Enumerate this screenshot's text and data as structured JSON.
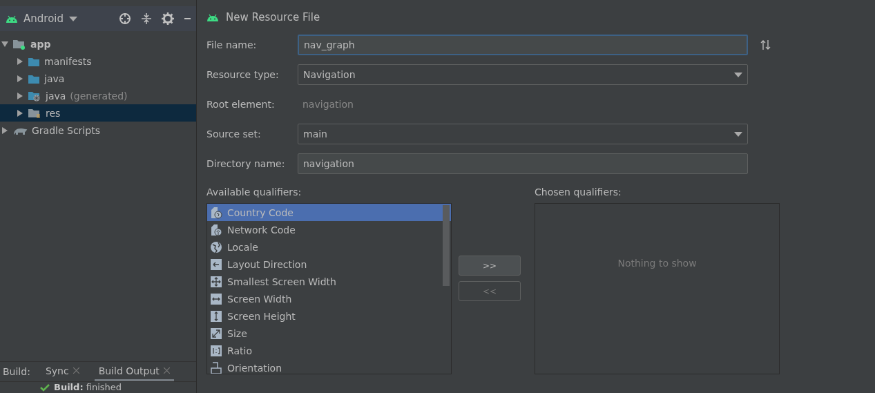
{
  "project_panel": {
    "view_selector": {
      "label": "Android"
    },
    "tree": [
      {
        "label": "app",
        "kind": "module",
        "expanded": true,
        "selected": false,
        "children": [
          {
            "label": "manifests",
            "kind": "folder",
            "expanded": false,
            "selected": false
          },
          {
            "label": "java",
            "kind": "folder",
            "expanded": false,
            "selected": false
          },
          {
            "label": "java",
            "suffix": "(generated)",
            "kind": "generated",
            "expanded": false,
            "selected": false
          },
          {
            "label": "res",
            "kind": "res",
            "expanded": false,
            "selected": true
          }
        ]
      },
      {
        "label": "Gradle Scripts",
        "kind": "gradle",
        "expanded": false,
        "selected": false
      }
    ]
  },
  "build_panel": {
    "label": "Build:",
    "tabs": [
      {
        "label": "Sync",
        "selected": false
      },
      {
        "label": "Build Output",
        "selected": true
      }
    ],
    "status": {
      "text": "**Build:** finished"
    }
  },
  "dialog": {
    "title": "New Resource File",
    "fields": [
      {
        "kind": "text",
        "label": "File name:",
        "value": "nav_graph",
        "focused": true
      },
      {
        "kind": "dropdown",
        "label": "Resource type:",
        "value": "Navigation"
      },
      {
        "kind": "readonly",
        "label": "Root element:",
        "value": "navigation"
      },
      {
        "kind": "dropdown",
        "label": "Source set:",
        "value": "main"
      },
      {
        "kind": "text",
        "label": "Directory name:",
        "value": "navigation",
        "focused": false
      }
    ],
    "available_label": "Available qualifiers:",
    "available": [
      {
        "label": "Country Code",
        "kind": "country",
        "selected": true
      },
      {
        "label": "Network Code",
        "kind": "network",
        "selected": false
      },
      {
        "label": "Locale",
        "kind": "globe",
        "selected": false
      },
      {
        "label": "Layout Direction",
        "kind": "direction",
        "selected": false
      },
      {
        "label": "Smallest Screen Width",
        "kind": "move",
        "selected": false
      },
      {
        "label": "Screen Width",
        "kind": "hwidth",
        "selected": false
      },
      {
        "label": "Screen Height",
        "kind": "vheight",
        "selected": false
      },
      {
        "label": "Size",
        "kind": "size",
        "selected": false
      },
      {
        "label": "Ratio",
        "kind": "ratio",
        "selected": false
      },
      {
        "label": "Orientation",
        "kind": "orientation",
        "selected": false
      }
    ],
    "add_button": {
      "label": ">>",
      "disabled": false
    },
    "remove_button": {
      "label": "<<",
      "disabled": true
    },
    "chosen_label": "Chosen qualifiers:",
    "chosen_empty": "Nothing to show"
  }
}
